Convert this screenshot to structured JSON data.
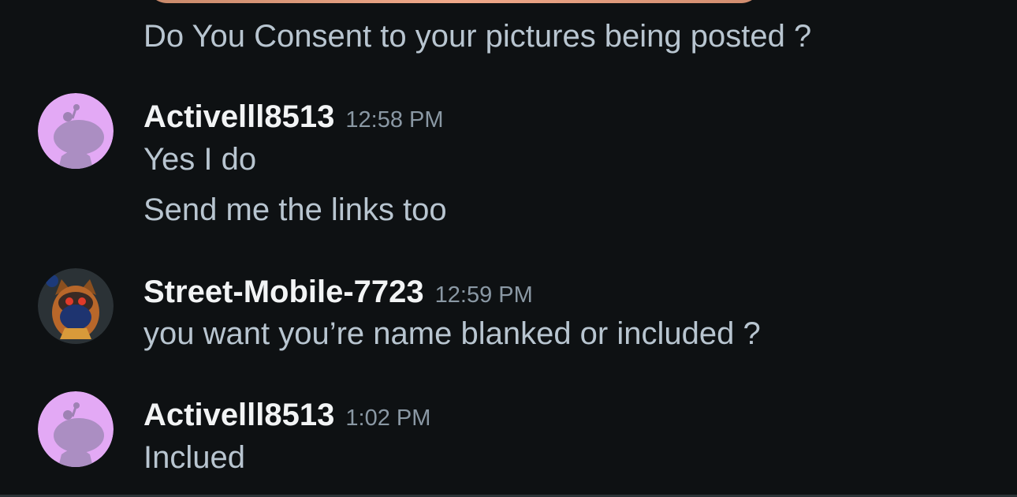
{
  "thread": {
    "prev_message": {
      "text": "Do You Consent to your pictures being posted ?"
    },
    "messages": [
      {
        "username": "Activelll8513",
        "time": "12:58 PM",
        "avatar_icon": "snoo-avatar-icon",
        "avatar_color": "#e3a9f5",
        "lines": [
          "Yes I do",
          "Send me the links too"
        ]
      },
      {
        "username": "Street-Mobile-7723",
        "time": "12:59 PM",
        "avatar_icon": "owl-avatar-icon",
        "avatar_color": "#2b3236",
        "lines": [
          "you want you’re name blanked or included ?"
        ]
      },
      {
        "username": "Activelll8513",
        "time": "1:02 PM",
        "avatar_icon": "snoo-avatar-icon",
        "avatar_color": "#e3a9f5",
        "lines": [
          "Inclued"
        ]
      }
    ]
  },
  "colors": {
    "background": "#0e1113",
    "message_text": "#b8c5d0",
    "username": "#f2f4f5",
    "timestamp": "#8a98a4"
  }
}
